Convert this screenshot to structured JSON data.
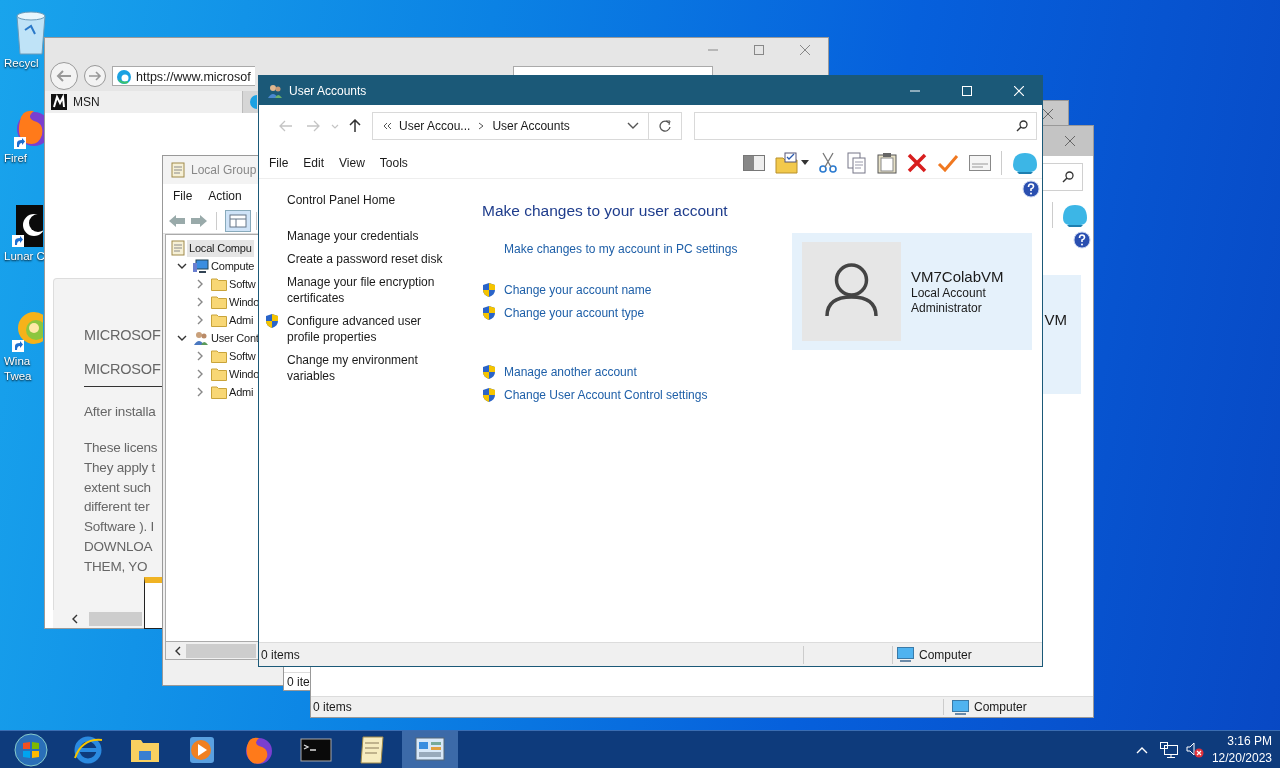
{
  "desktop_icons": [
    {
      "kind": "trash",
      "lines": [
        "Recycl"
      ]
    },
    {
      "kind": "fox",
      "lines": [
        "Firef"
      ]
    },
    {
      "kind": "moon",
      "lines": [
        "Lunar C"
      ]
    },
    {
      "kind": "tweaker",
      "lines": [
        "Wina",
        "Twea"
      ]
    }
  ],
  "browser": {
    "address": "https://www.microsof",
    "tabs": [
      {
        "label": "MSN",
        "selected": true
      }
    ],
    "document": {
      "headings": [
        "MICROSOF",
        "MICROSOF"
      ],
      "intro": "After installa",
      "paragraph_lines": [
        "These licens",
        "They apply t",
        "extent such",
        "different ter",
        "Software ). I",
        "DOWNLOA",
        "THEM, YO"
      ]
    }
  },
  "policy_window": {
    "title": "Local Group",
    "menu": [
      "File",
      "Action"
    ],
    "tree": [
      {
        "label": "Local Compu",
        "kind": "policy",
        "selected": true,
        "children": [
          {
            "label": "Compute",
            "kind": "computer",
            "selected": false,
            "expanded": true,
            "children": [
              {
                "label": "Softw",
                "kind": "folder",
                "selected": false,
                "expanded": false
              },
              {
                "label": "Windo",
                "kind": "folder",
                "selected": false,
                "expanded": false
              },
              {
                "label": "Admi",
                "kind": "folder",
                "selected": false,
                "expanded": false
              }
            ]
          },
          {
            "label": "User Cont",
            "kind": "user",
            "selected": false,
            "expanded": true,
            "children": [
              {
                "label": "Softw",
                "kind": "folder",
                "selected": false,
                "expanded": false
              },
              {
                "label": "Windo",
                "kind": "folder",
                "selected": false,
                "expanded": false
              },
              {
                "label": "Admi",
                "kind": "folder",
                "selected": false,
                "expanded": false
              }
            ]
          }
        ]
      }
    ]
  },
  "explorer_window_2": {
    "status": "0 ite"
  },
  "explorer_window_3": {
    "account_name": "VM",
    "status": "0 items",
    "location": "Computer"
  },
  "user_accounts": {
    "title": "User Accounts",
    "nav_buttons": [
      {
        "kind": "back",
        "disabled": true
      },
      {
        "kind": "forward",
        "disabled": true
      },
      {
        "kind": "recent",
        "disabled": true
      },
      {
        "kind": "up",
        "disabled": false
      }
    ],
    "breadcrumb": [
      "User Accou...",
      "User Accounts"
    ],
    "menu": [
      "File",
      "Edit",
      "View",
      "Tools"
    ],
    "home_link": "Control Panel Home",
    "tasks": [
      {
        "label": "Manage your credentials",
        "shield": false
      },
      {
        "label": "Create a password reset disk",
        "shield": false
      },
      {
        "label": "Manage your file encryption certificates",
        "shield": false
      },
      {
        "label": "Configure advanced user profile properties",
        "shield": true
      },
      {
        "label": "Change my environment variables",
        "shield": false
      }
    ],
    "heading": "Make changes to your user account",
    "settings_link": "Make changes to my account in PC settings",
    "link_groups": [
      [
        {
          "label": "Change your account name",
          "shield": true
        },
        {
          "label": "Change your account type",
          "shield": true
        }
      ],
      [
        {
          "label": "Manage another account",
          "shield": true
        },
        {
          "label": "Change User Account Control settings",
          "shield": true
        }
      ]
    ],
    "account": {
      "name": "VM7ColabVM",
      "details": [
        "Local Account",
        "Administrator"
      ]
    },
    "status": "0 items",
    "location": "Computer"
  },
  "taskbar": {
    "apps": [
      {
        "kind": "ie",
        "selected": false
      },
      {
        "kind": "explorer",
        "selected": false
      },
      {
        "kind": "media",
        "selected": false
      },
      {
        "kind": "fox",
        "selected": false
      },
      {
        "kind": "terminal",
        "selected": false
      },
      {
        "kind": "notepad",
        "selected": false
      },
      {
        "kind": "control-panel",
        "selected": true
      }
    ],
    "volume_muted": true,
    "time": "3:16 PM",
    "date": "12/20/2023"
  }
}
